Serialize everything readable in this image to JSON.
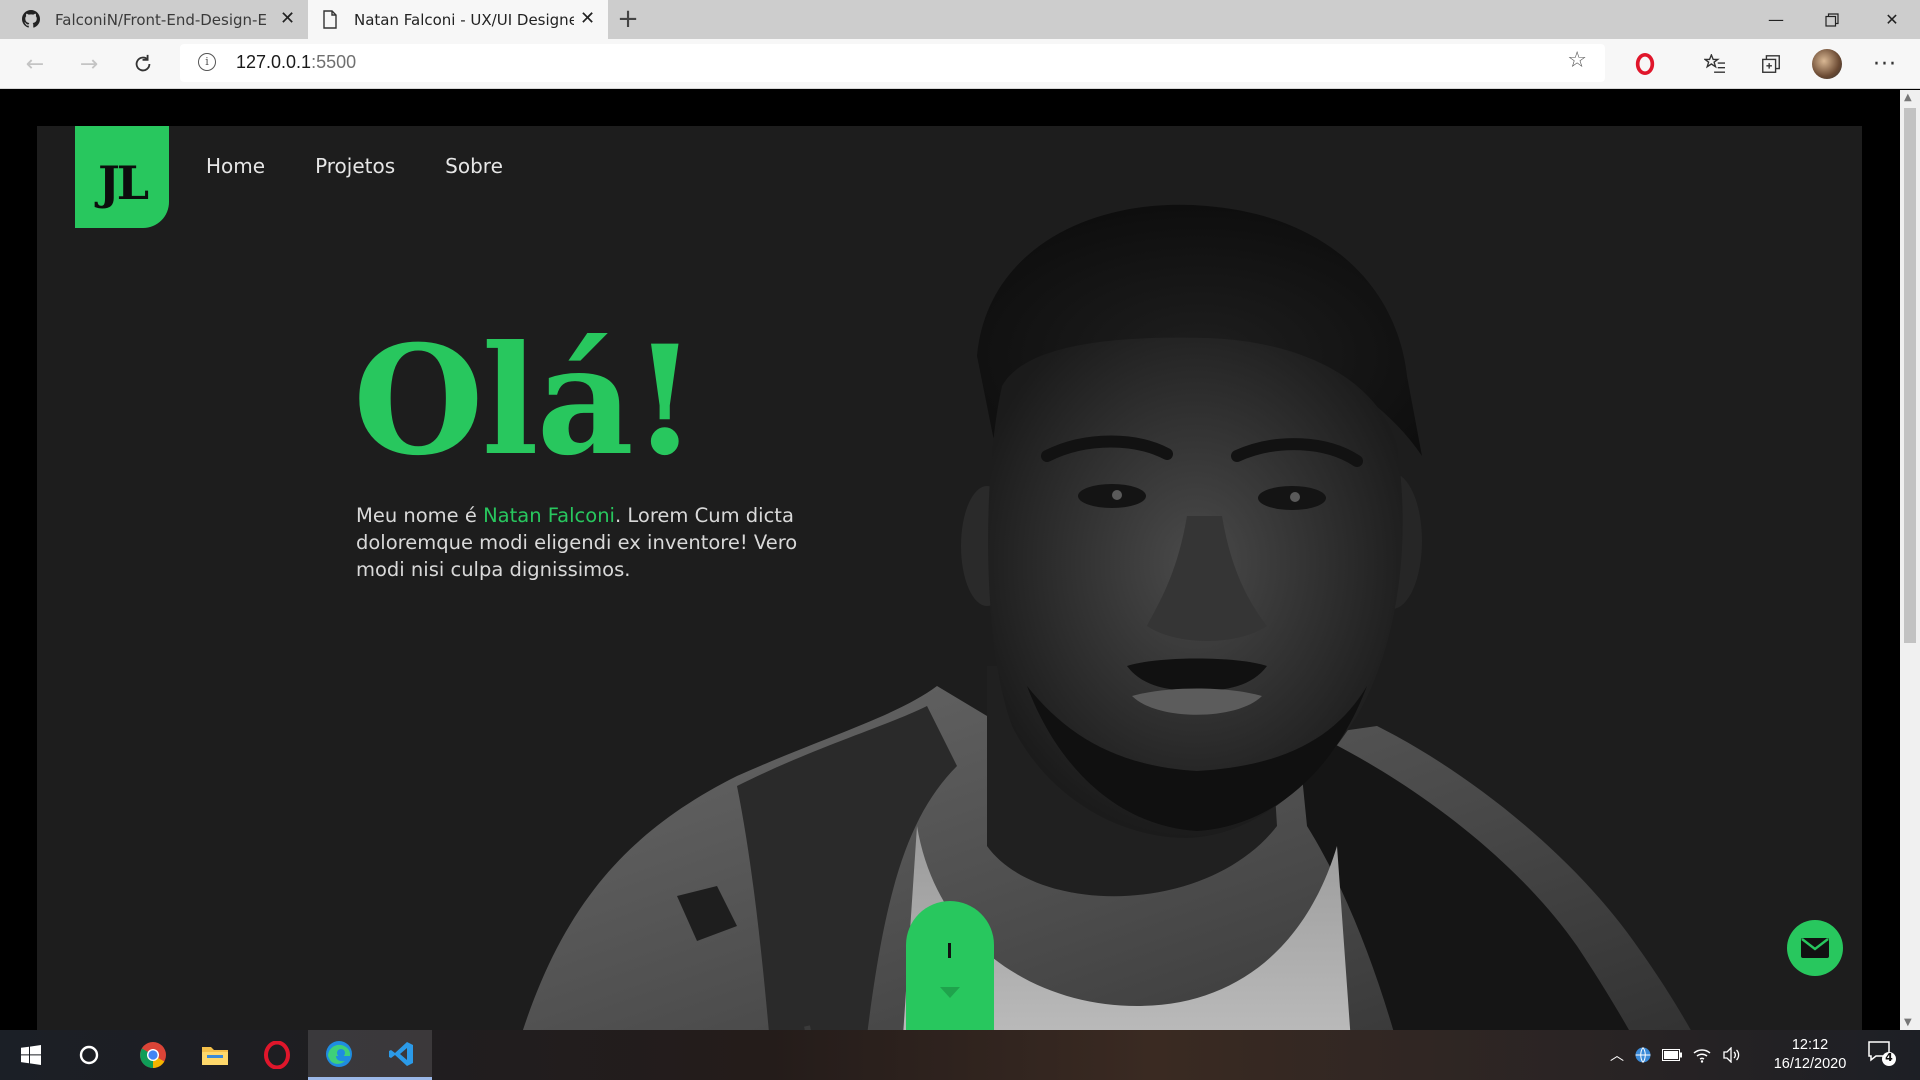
{
  "browser": {
    "tabs": [
      {
        "title": "FalconiN/Front-End-Design-Esse",
        "icon": "github-icon",
        "active": false
      },
      {
        "title": "Natan Falconi - UX/UI Designer",
        "icon": "page-icon",
        "active": true
      }
    ],
    "url_host": "127.0.0.1",
    "url_port": ":5500"
  },
  "page": {
    "logo": "JL",
    "nav": [
      "Home",
      "Projetos",
      "Sobre"
    ],
    "greeting": "Olá!",
    "intro_before": "Meu nome é ",
    "intro_name": "Natan Falconi",
    "intro_after": ". Lorem Cum dicta doloremque modi eligendi ex inventore! Vero modi nisi culpa dignissimos.",
    "accent": "#28c75e",
    "background": "#1d1d1d"
  },
  "taskbar": {
    "apps": [
      "windows-start",
      "cortana-search",
      "chrome",
      "file-explorer",
      "opera",
      "edge",
      "vscode"
    ],
    "time": "12:12",
    "date": "16/12/2020",
    "notifications": "4"
  }
}
